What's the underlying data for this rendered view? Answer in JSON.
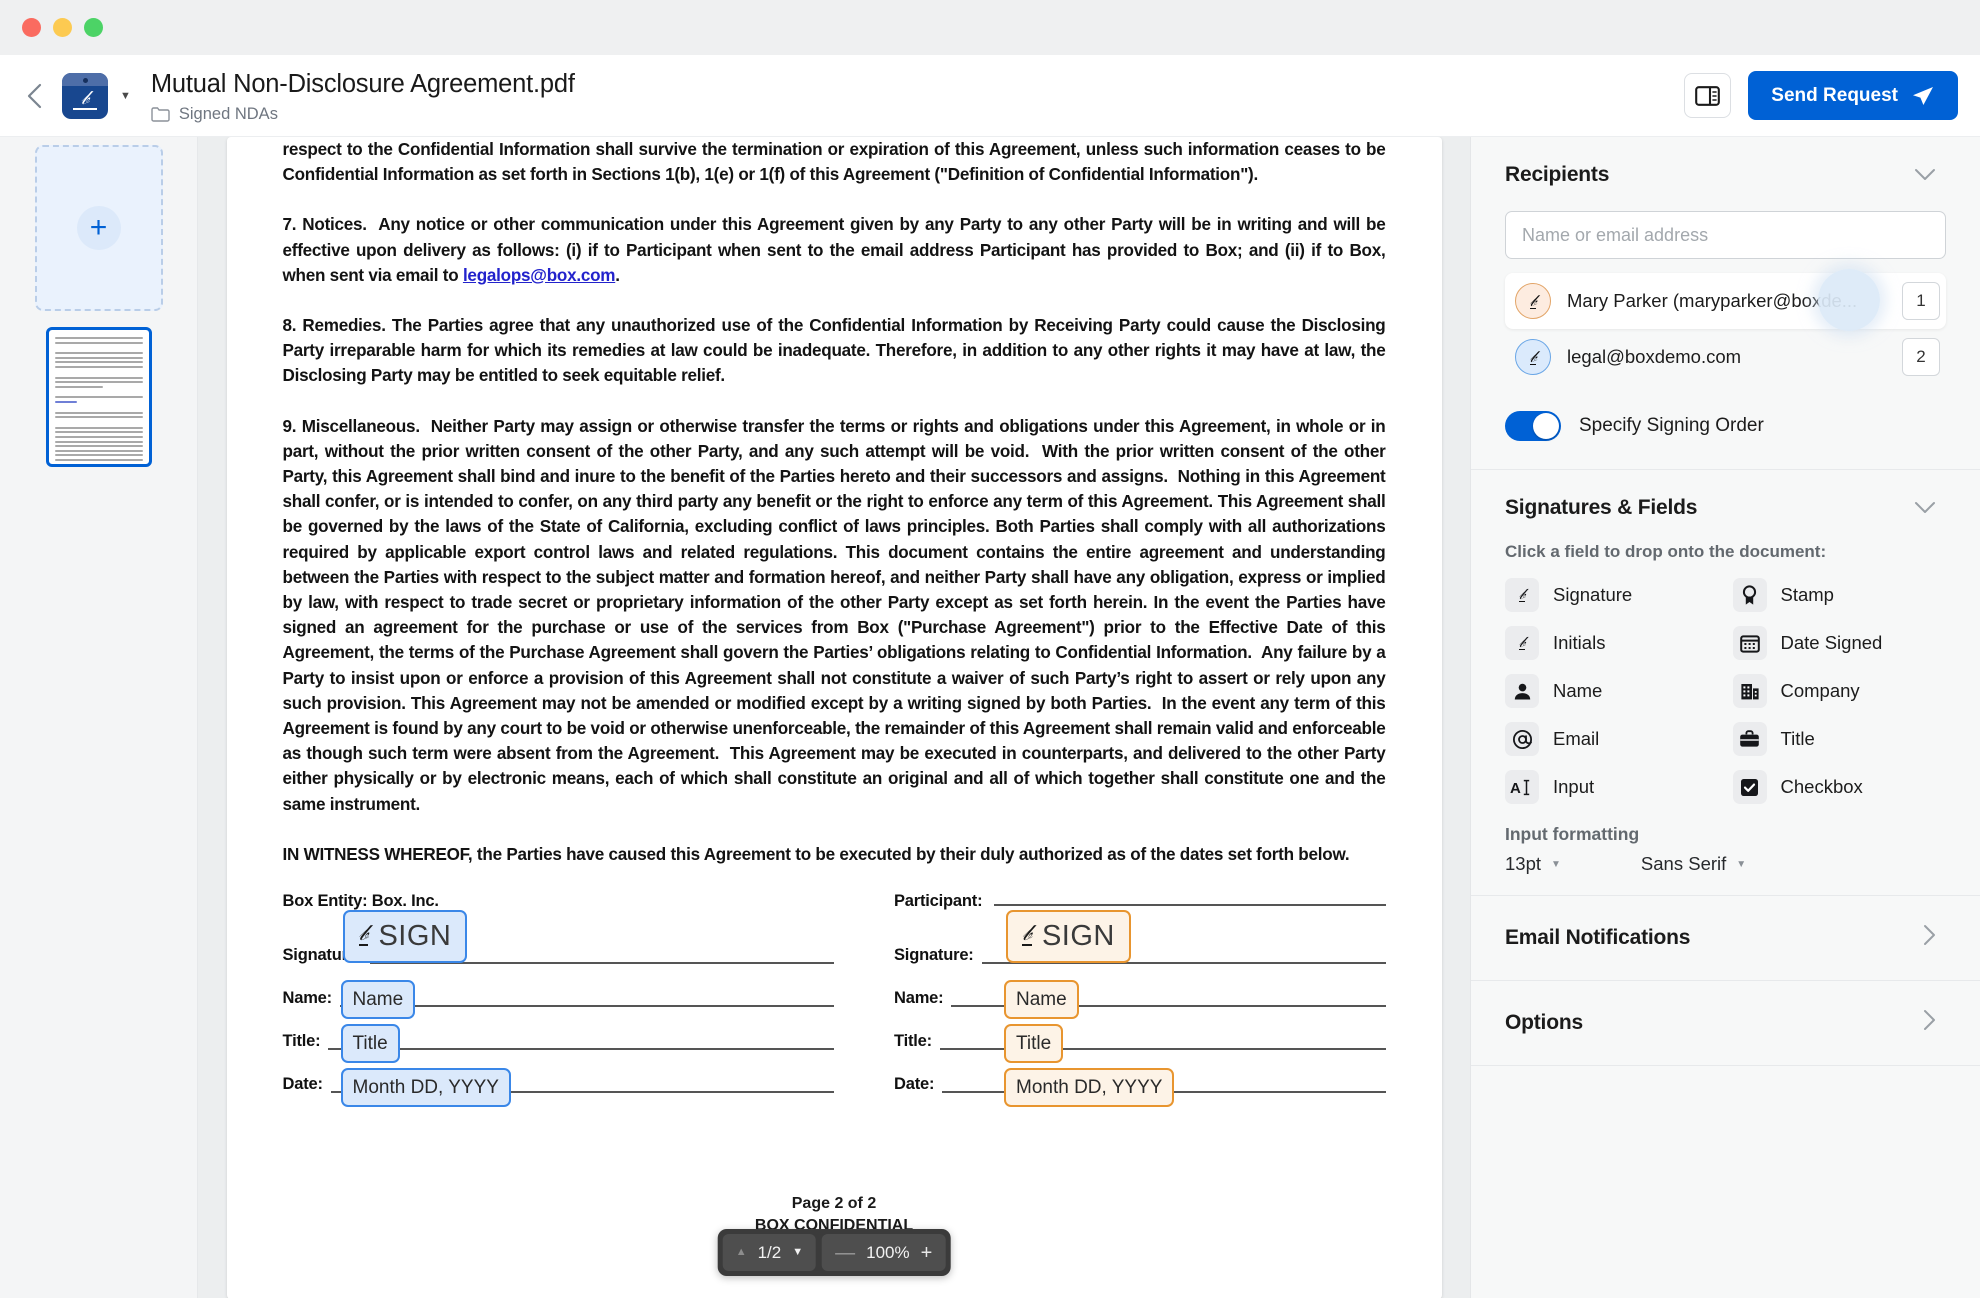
{
  "window": {
    "lights": [
      "close",
      "minimize",
      "zoom"
    ]
  },
  "header": {
    "title": "Mutual Non-Disclosure Agreement.pdf",
    "breadcrumb": "Signed NDAs",
    "back_icon": "chevron-left-icon",
    "doc_icon": "box-sign-document-icon",
    "caret_icon": "caret-down-icon",
    "folder_icon": "folder-icon",
    "panel_toggle_icon": "side-panel-toggle-icon",
    "send_label": "Send Request",
    "send_icon": "paper-plane-icon",
    "accent_color": "#0061d5"
  },
  "rail": {
    "add_page_label": "+",
    "add_page_name": "add-page-placeholder",
    "thumbnail_name": "page-thumbnail-1"
  },
  "document": {
    "paragraphs": [
      "respect to the Confidential Information shall survive the termination or expiration of this Agreement, unless such information ceases to be Confidential Information as set forth in Sections 1(b), 1(e) or 1(f) of this Agreement (\"Definition of Confidential Information\").",
      "7. Notices.  Any notice or other communication under this Agreement given by any Party to any other Party will be in writing and will be effective upon delivery as follows: (i) if to Participant when sent to the email address Participant has provided to Box; and (ii) if to Box, when sent via email to legalops@box.com.",
      "8. Remedies. The Parties agree that any unauthorized use of the Confidential Information by Receiving Party could cause the Disclosing Party irreparable harm for which its remedies at law could be inadequate. Therefore, in addition to any other rights it may have at law, the Disclosing Party may be entitled to seek equitable relief.",
      "9. Miscellaneous.  Neither Party may assign or otherwise transfer the terms or rights and obligations under this Agreement, in whole or in part, without the prior written consent of the other Party, and any such attempt will be void.  With the prior written consent of the other Party, this Agreement shall bind and inure to the benefit of the Parties hereto and their successors and assigns.  Nothing in this Agreement shall confer, or is intended to confer, on any third party any benefit or the right to enforce any term of this Agreement.  This Agreement shall be governed by the laws of the State of California, excluding conflict of laws principles. Both Parties shall comply with all authorizations required by applicable export control laws and related regulations. This document contains the entire agreement and understanding between the Parties with respect to the subject matter and formation hereof, and neither Party shall have any obligation, express or implied by law, with respect to trade secret or proprietary information of the other Party except as set forth herein. In the event the Parties have signed an agreement for the purchase or use of the services from Box (\"Purchase Agreement\") prior to the Effective Date of this Agreement, the terms of the Purchase Agreement shall govern the Parties' obligations relating to Confidential Information.  Any failure by a Party to insist upon or enforce a provision of this Agreement shall not constitute a waiver of such Party's right to assert or rely upon any such provision. This Agreement may not be amended or modified except by a writing signed by both Parties.  In the event any term of this Agreement is found by any court to be void or otherwise unenforceable, the remainder of this Agreement shall remain valid and enforceable as though such term were absent from the Agreement.  This Agreement may be executed in counterparts, and delivered to the other Party either physically or by electronic means, each of which shall constitute an original and all of which together shall constitute one and the same instrument.",
      "IN WITNESS WHEREOF, the Parties have caused this Agreement to be executed by their duly authorized as of the dates set forth below."
    ],
    "email_link": "legalops@box.com",
    "signature_blocks": [
      {
        "heading": "Box Entity: Box. Inc.",
        "color": "blue",
        "rows": [
          {
            "label": "Signature:",
            "field": "SIGN"
          },
          {
            "label": "Name:",
            "field": "Name"
          },
          {
            "label": "Title:",
            "field": "Title"
          },
          {
            "label": "Date:",
            "field": "Month DD, YYYY"
          }
        ]
      },
      {
        "heading": "Participant:",
        "color": "orange",
        "rows": [
          {
            "label": "Signature:",
            "field": "SIGN"
          },
          {
            "label": "Name:",
            "field": "Name"
          },
          {
            "label": "Title:",
            "field": "Title"
          },
          {
            "label": "Date:",
            "field": "Month DD, YYYY"
          }
        ]
      }
    ],
    "footer_page": "Page 2 of 2",
    "footer_label": "BOX CONFIDENTIAL"
  },
  "pager": {
    "page_indicator": "1/2",
    "zoom_level": "100%",
    "up_icon": "triangle-up-icon",
    "down_icon": "triangle-down-icon",
    "minus_label": "—",
    "plus_label": "+"
  },
  "panel": {
    "recipients": {
      "title": "Recipients",
      "collapse_icon": "chevron-down-icon",
      "input_placeholder": "Name or email address",
      "items": [
        {
          "name": "Mary Parker (maryparker@boxde...",
          "order": "1",
          "avatar": "signature-avatar-peach",
          "selected": true
        },
        {
          "name": "legal@boxdemo.com",
          "order": "2",
          "avatar": "signature-avatar-blue",
          "selected": false
        }
      ],
      "signing_order_label": "Specify Signing Order",
      "signing_order_on": true
    },
    "fields": {
      "title": "Signatures & Fields",
      "collapse_icon": "chevron-down-icon",
      "hint": "Click a field to drop onto the document:",
      "items": [
        {
          "label": "Signature",
          "icon": "signature-icon"
        },
        {
          "label": "Stamp",
          "icon": "stamp-icon"
        },
        {
          "label": "Initials",
          "icon": "initials-icon"
        },
        {
          "label": "Date Signed",
          "icon": "calendar-icon"
        },
        {
          "label": "Name",
          "icon": "person-icon"
        },
        {
          "label": "Company",
          "icon": "building-icon"
        },
        {
          "label": "Email",
          "icon": "at-sign-icon"
        },
        {
          "label": "Title",
          "icon": "briefcase-icon"
        },
        {
          "label": "Input",
          "icon": "text-input-icon"
        },
        {
          "label": "Checkbox",
          "icon": "checkbox-icon"
        }
      ],
      "formatting_label": "Input formatting",
      "font_size": "13pt",
      "font_family": "Sans Serif"
    },
    "accordions": [
      {
        "label": "Email Notifications",
        "icon": "chevron-right-icon"
      },
      {
        "label": "Options",
        "icon": "chevron-right-icon"
      }
    ]
  }
}
